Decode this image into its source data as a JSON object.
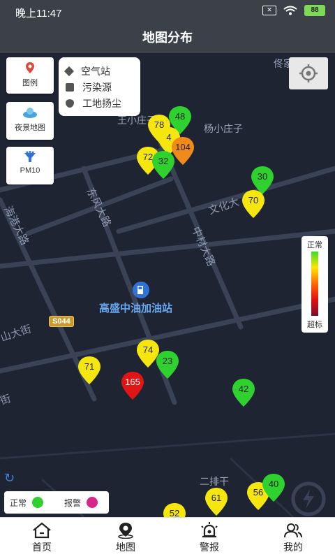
{
  "status_bar": {
    "time": "晚上11:47",
    "battery": "88"
  },
  "title": "地图分布",
  "tools": [
    {
      "label": "图例",
      "icon": "map-pin-icon"
    },
    {
      "label": "夜景地图",
      "icon": "night-map-icon"
    },
    {
      "label": "PM10",
      "icon": "filter-icon"
    }
  ],
  "legend_popup": [
    "空气站",
    "污染源",
    "工地扬尘"
  ],
  "scale": {
    "top": "正常",
    "bottom": "超标"
  },
  "map_labels": {
    "village_top": "佟家镇",
    "wangxiaozhuang": "王小庄子",
    "yangxiaozhuang": "杨小庄子",
    "wenhua": "文化大",
    "dongfeng": "东风大路",
    "haigang": "海港大路",
    "zhongcai": "中材大路",
    "shan_street": "山大街",
    "jie": "街",
    "erpaigan": "二排干",
    "poi": "高盛中油加油站",
    "shield": "S044"
  },
  "markers": [
    {
      "value": "48",
      "color": "#2ed12e"
    },
    {
      "value": "78",
      "color": "#f5e60f"
    },
    {
      "value": "4",
      "color": "#f5e60f"
    },
    {
      "value": "104",
      "color": "#f08a1a"
    },
    {
      "value": "72",
      "color": "#f5e60f"
    },
    {
      "value": "32",
      "color": "#2ed12e"
    },
    {
      "value": "30",
      "color": "#2ed12e"
    },
    {
      "value": "70",
      "color": "#f5e60f"
    },
    {
      "value": "74",
      "color": "#f5e60f"
    },
    {
      "value": "23",
      "color": "#2ed12e"
    },
    {
      "value": "71",
      "color": "#f5e60f"
    },
    {
      "value": "165",
      "color": "#e01515"
    },
    {
      "value": "42",
      "color": "#2ed12e"
    },
    {
      "value": "61",
      "color": "#f5e60f"
    },
    {
      "value": "56",
      "color": "#f5e60f"
    },
    {
      "value": "40",
      "color": "#2ed12e"
    },
    {
      "value": "52",
      "color": "#f5e60f"
    }
  ],
  "status_legend": {
    "normal": "正常",
    "alarm": "报警",
    "normal_color": "#2ed12e",
    "alarm_color": "#d6288a"
  },
  "nav": [
    "首页",
    "地图",
    "警报",
    "我的"
  ]
}
